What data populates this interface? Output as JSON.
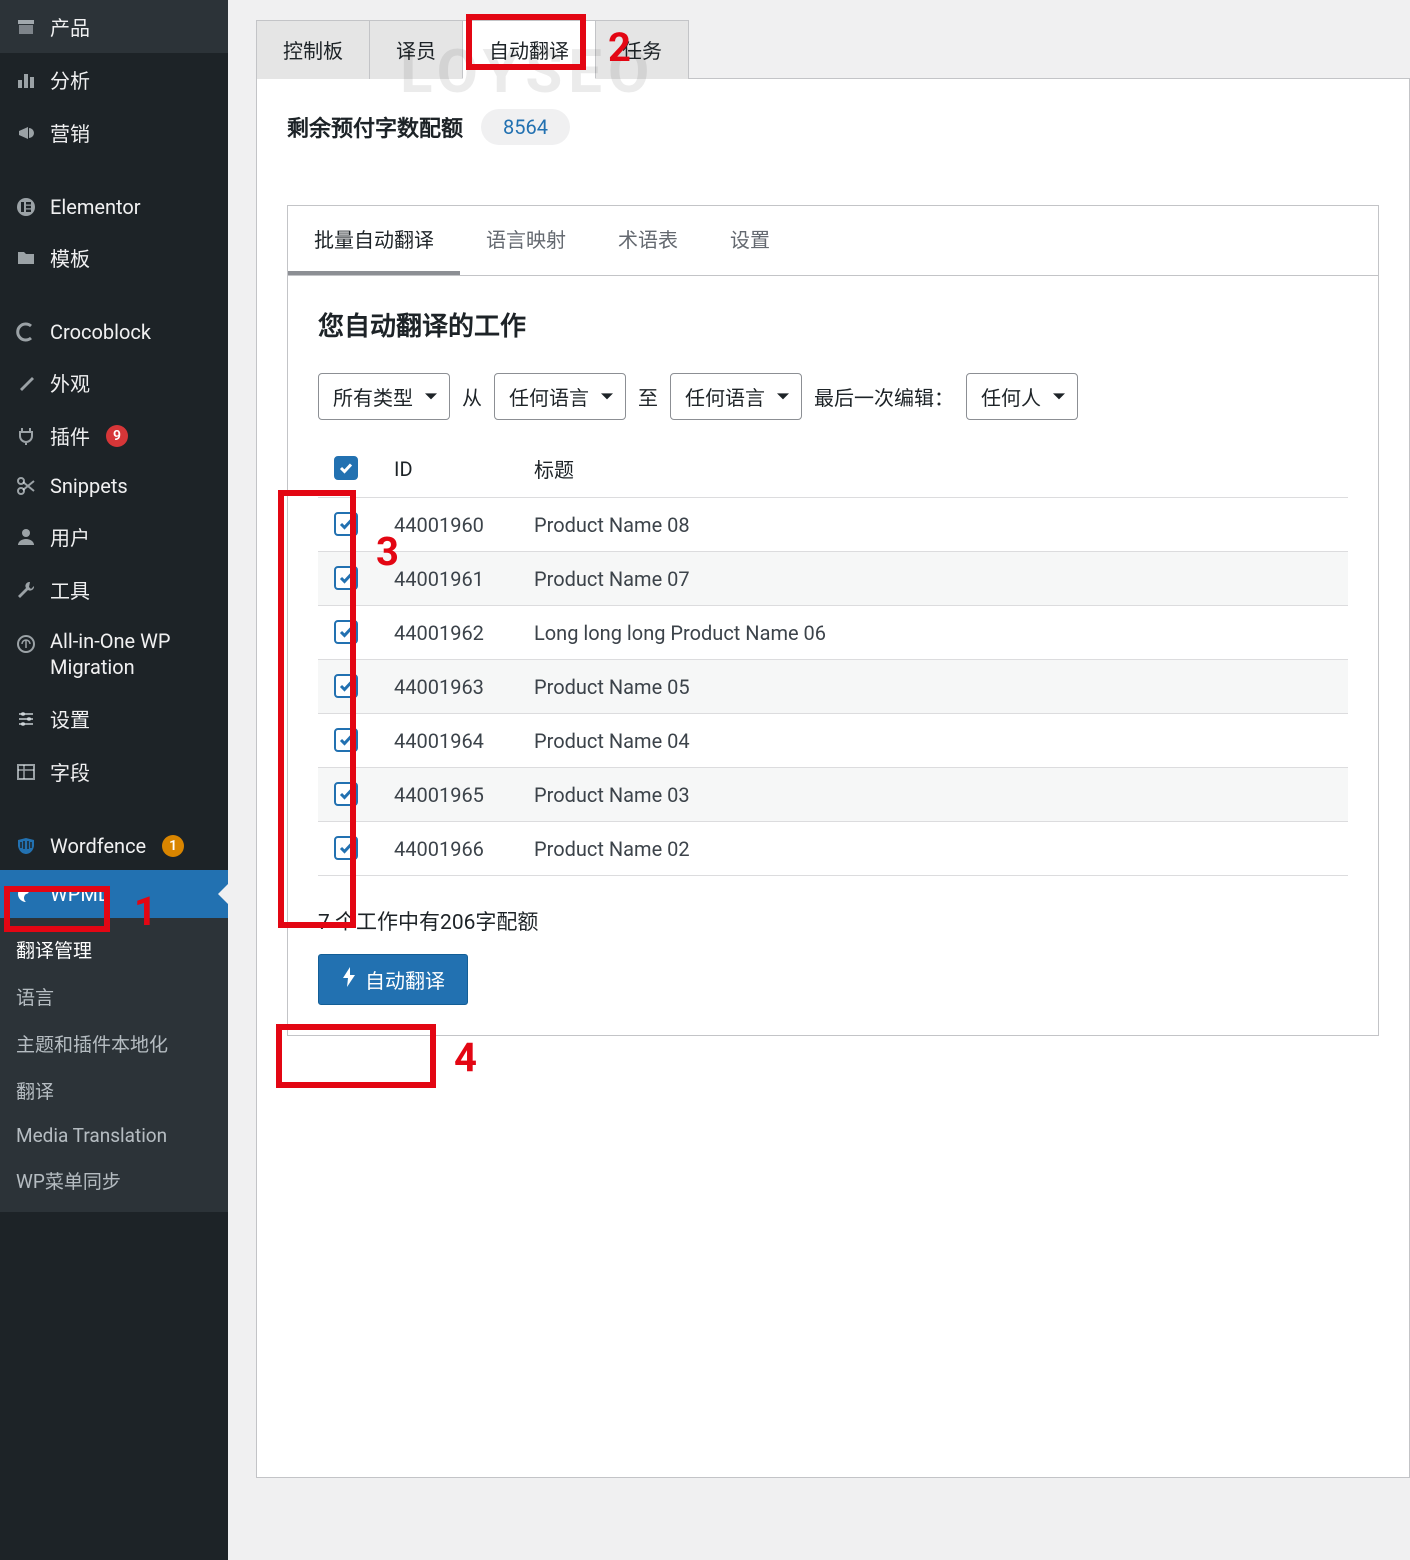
{
  "watermark": "LOYSEO",
  "sidebar": {
    "items": [
      {
        "icon": "archive",
        "label": "产品"
      },
      {
        "icon": "chart",
        "label": "分析"
      },
      {
        "icon": "megaphone",
        "label": "营销"
      },
      {
        "icon": "elementor",
        "label": "Elementor"
      },
      {
        "icon": "folder",
        "label": "模板"
      },
      {
        "icon": "croco",
        "label": "Crocoblock"
      },
      {
        "icon": "brush",
        "label": "外观"
      },
      {
        "icon": "plug",
        "label": "插件",
        "badge": "9",
        "badge_color": "red"
      },
      {
        "icon": "scissors",
        "label": "Snippets"
      },
      {
        "icon": "user",
        "label": "用户"
      },
      {
        "icon": "wrench",
        "label": "工具"
      },
      {
        "icon": "migration",
        "label": "All-in-One WP Migration"
      },
      {
        "icon": "sliders",
        "label": "设置"
      },
      {
        "icon": "fields",
        "label": "字段"
      },
      {
        "icon": "shield",
        "label": "Wordfence",
        "badge": "1",
        "badge_color": "orange"
      },
      {
        "icon": "wpml",
        "label": "WPML",
        "active": true
      }
    ],
    "submenu": [
      {
        "label": "翻译管理",
        "current": true
      },
      {
        "label": "语言"
      },
      {
        "label": "主题和插件本地化"
      },
      {
        "label": "翻译"
      },
      {
        "label": "Media Translation"
      },
      {
        "label": "WP菜单同步"
      }
    ]
  },
  "tabs": {
    "items": [
      {
        "label": "控制板"
      },
      {
        "label": "译员"
      },
      {
        "label": "自动翻译",
        "active": true
      },
      {
        "label": "任务"
      }
    ]
  },
  "quota": {
    "label": "剩余预付字数配额",
    "value": "8564"
  },
  "inner_tabs": [
    {
      "label": "批量自动翻译",
      "active": true
    },
    {
      "label": "语言映射"
    },
    {
      "label": "术语表"
    },
    {
      "label": "设置"
    }
  ],
  "section_title": "您自动翻译的工作",
  "filters": {
    "type": "所有类型",
    "from_label": "从",
    "from": "任何语言",
    "to_label": "至",
    "to": "任何语言",
    "last_edit_label": "最后一次编辑：",
    "last_edit": "任何人"
  },
  "table": {
    "headers": {
      "id": "ID",
      "title": "标题"
    },
    "rows": [
      {
        "id": "44001960",
        "title": "Product Name 08"
      },
      {
        "id": "44001961",
        "title": "Product Name 07"
      },
      {
        "id": "44001962",
        "title": "Long long long Product Name 06"
      },
      {
        "id": "44001963",
        "title": "Product Name 05"
      },
      {
        "id": "44001964",
        "title": "Product Name 04"
      },
      {
        "id": "44001965",
        "title": "Product Name 03"
      },
      {
        "id": "44001966",
        "title": "Product Name 02"
      }
    ]
  },
  "summary": "7 个工作中有206字配额",
  "button_label": "自动翻译",
  "annotations": {
    "n1": "1",
    "n2": "2",
    "n3": "3",
    "n4": "4"
  }
}
